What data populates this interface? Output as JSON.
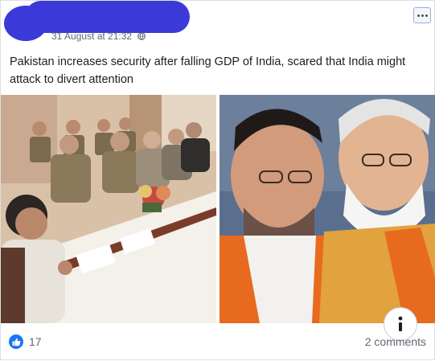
{
  "post": {
    "timestamp": "31 August at 21:32",
    "text": "Pakistan increases security after falling GDP of India, scared that India might attack to divert attention",
    "privacy_icon": "globe-icon",
    "more_icon": "more-options-icon"
  },
  "photos": [
    {
      "name": "left-photo",
      "description_icon": "meeting-room-photo"
    },
    {
      "name": "right-photo",
      "description_icon": "two-men-photo"
    }
  ],
  "footer": {
    "reaction_icon": "thumbs-up-icon",
    "like_count": "17",
    "comments_label": "2 comments"
  },
  "colors": {
    "brand_blue": "#1877f2",
    "redaction_blue": "#3b3ad9",
    "secondary_text": "#606770"
  }
}
